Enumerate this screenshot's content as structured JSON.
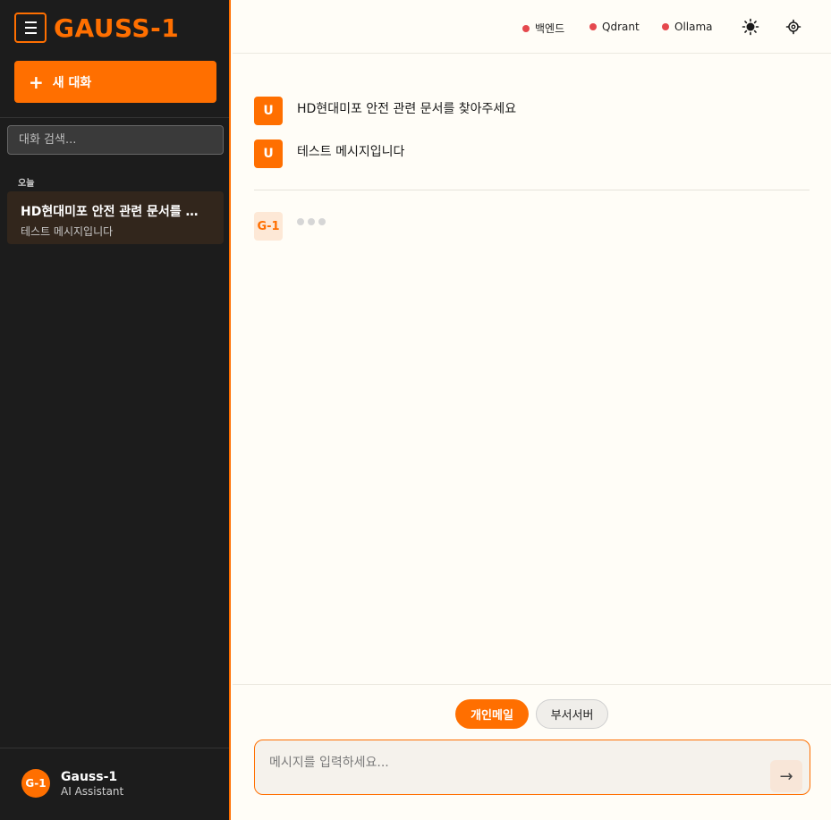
{
  "app": {
    "logo": "GAUSS-1",
    "accent_color": "#ff6f00"
  },
  "sidebar": {
    "new_chat_label": "새 대화",
    "search_placeholder": "대화 검색...",
    "section_today": "오늘",
    "conversations": [
      {
        "title": "HD현대미포 안전 관련 문서를 찾아주세요",
        "preview": "테스트 메시지입니다"
      }
    ],
    "profile": {
      "avatar": "G-1",
      "name": "Gauss-1",
      "role": "AI Assistant"
    }
  },
  "header": {
    "status": [
      {
        "label": "백엔드",
        "state_color": "#e5484d"
      },
      {
        "label": "Qdrant",
        "state_color": "#e5484d"
      },
      {
        "label": "Ollama",
        "state_color": "#e5484d"
      }
    ],
    "icons": [
      "theme-toggle-icon",
      "settings-icon"
    ]
  },
  "messages": {
    "user_avatar": "U",
    "bot_avatar": "G-1",
    "items": [
      {
        "role": "user",
        "text": "HD현대미포 안전 관련 문서를 찾아주세요"
      },
      {
        "role": "user",
        "text": "테스트 메시지입니다"
      }
    ]
  },
  "composer": {
    "modes": [
      {
        "label": "개인메일",
        "active": true
      },
      {
        "label": "부서서버",
        "active": false
      }
    ],
    "placeholder": "메시지를 입력하세요...",
    "send_symbol": "→"
  }
}
